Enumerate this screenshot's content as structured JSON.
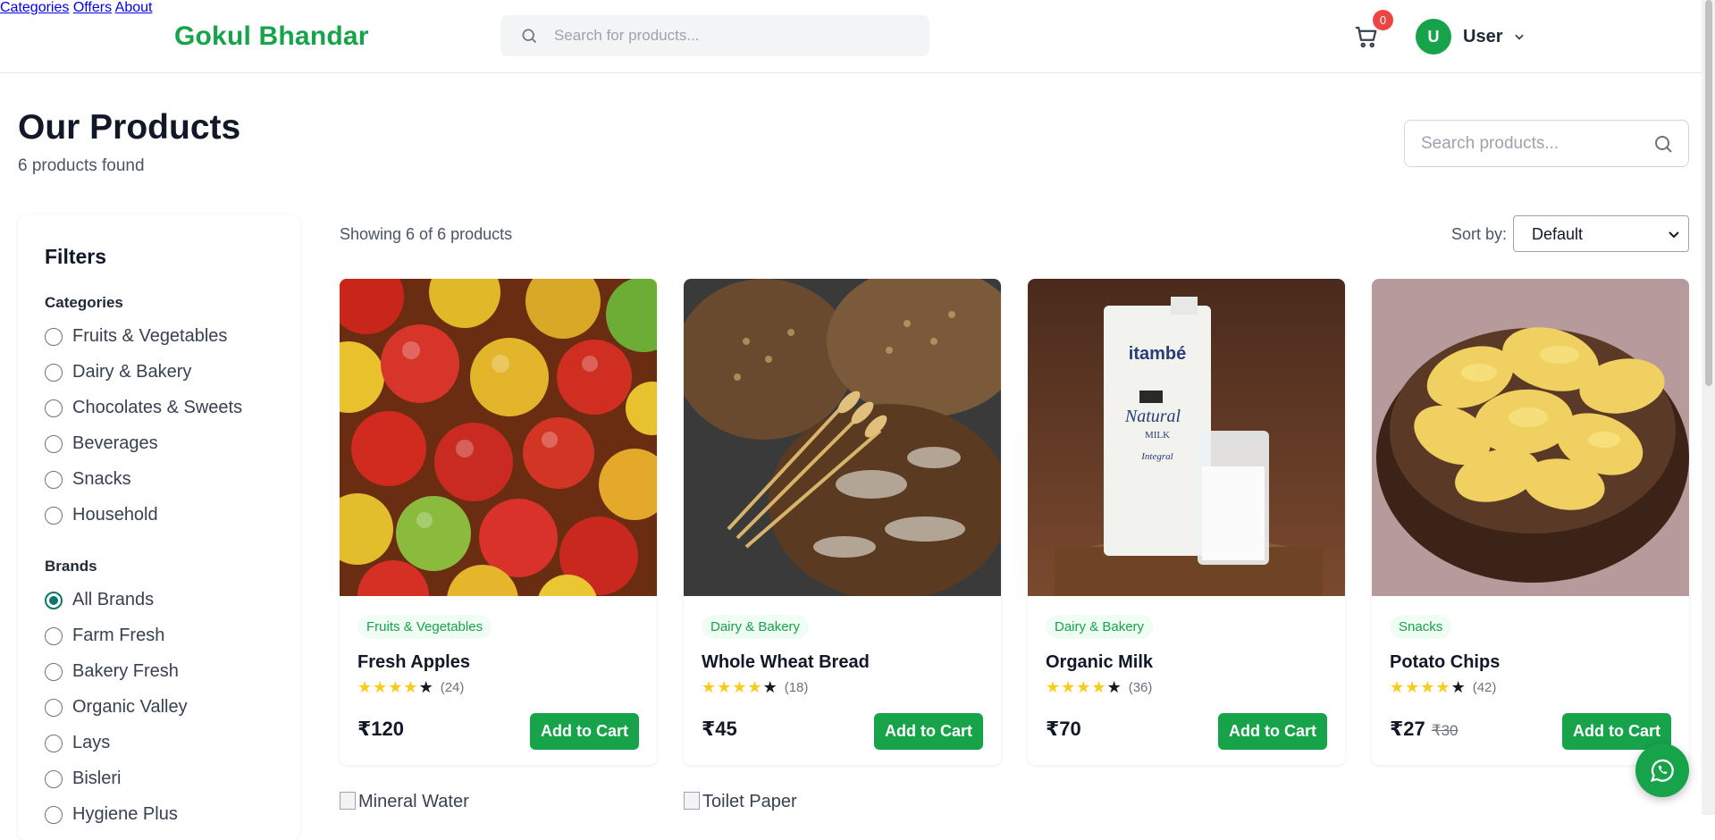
{
  "header": {
    "logo": "Gokul Bhandar",
    "search_placeholder": "Search for products...",
    "nav": [
      "Categories",
      "Offers",
      "About"
    ],
    "cart_count": "0",
    "user_initial": "U",
    "user_name": "User"
  },
  "page": {
    "title": "Our Products",
    "count_text": "6 products found",
    "search_placeholder": "Search products..."
  },
  "filters": {
    "title": "Filters",
    "categories_heading": "Categories",
    "categories": [
      "Fruits & Vegetables",
      "Dairy & Bakery",
      "Chocolates & Sweets",
      "Beverages",
      "Snacks",
      "Household"
    ],
    "brands_heading": "Brands",
    "brands": [
      "All Brands",
      "Farm Fresh",
      "Bakery Fresh",
      "Organic Valley",
      "Lays",
      "Bisleri",
      "Hygiene Plus"
    ],
    "selected_brand": "All Brands"
  },
  "toolbar": {
    "showing": "Showing 6 of 6 products",
    "sort_label": "Sort by:",
    "sort_value": "Default"
  },
  "products": [
    {
      "category": "Fruits & Vegetables",
      "name": "Fresh Apples",
      "rating": 4.5,
      "reviews": "(24)",
      "price": "₹120",
      "old_price": "",
      "button": "Add to Cart"
    },
    {
      "category": "Dairy & Bakery",
      "name": "Whole Wheat Bread",
      "rating": 4.5,
      "reviews": "(18)",
      "price": "₹45",
      "old_price": "",
      "button": "Add to Cart"
    },
    {
      "category": "Dairy & Bakery",
      "name": "Organic Milk",
      "rating": 4.5,
      "reviews": "(36)",
      "price": "₹70",
      "old_price": "",
      "button": "Add to Cart"
    },
    {
      "category": "Snacks",
      "name": "Potato Chips",
      "rating": 4.5,
      "reviews": "(42)",
      "price": "₹27",
      "old_price": "₹30",
      "button": "Add to Cart"
    }
  ],
  "broken_images": [
    "Mineral Water",
    "Toilet Paper"
  ],
  "milk_pack": {
    "brand": "itambé",
    "line1": "Natural",
    "line2": "MILK",
    "line3": "Integral"
  },
  "colors": {
    "brand_green": "#16a34a",
    "badge_red": "#ef4444",
    "star_yellow": "#facc15"
  }
}
